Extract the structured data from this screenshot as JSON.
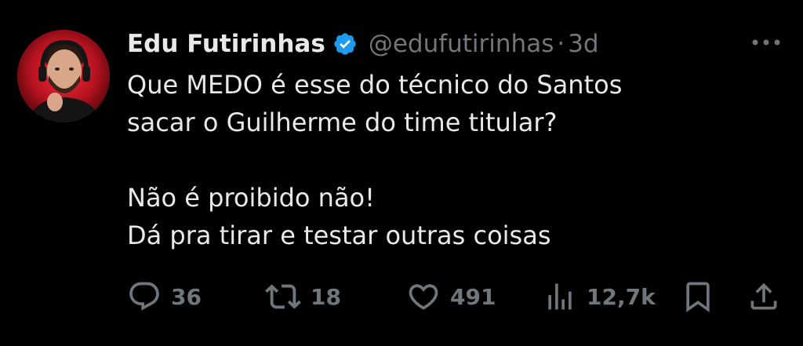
{
  "tweet": {
    "author": {
      "name": "Edu Futirinhas",
      "handle": "@edufutirinhas",
      "verified": true,
      "verified_color": "#1d9bf0"
    },
    "separator": "·",
    "time": "3d",
    "text_lines": [
      "Que MEDO é esse do técnico do Santos",
      "sacar o Guilherme do time titular?",
      "",
      "Não é proibido não!",
      "Dá pra tirar e testar outras coisas"
    ],
    "actions": {
      "replies": "36",
      "retweets": "18",
      "likes": "491",
      "views": "12,7k"
    },
    "icons": {
      "reply": "reply-icon",
      "retweet": "retweet-icon",
      "like": "heart-icon",
      "views": "views-icon",
      "bookmark": "bookmark-icon",
      "share": "share-icon",
      "more": "more-icon"
    }
  },
  "theme": {
    "background": "#000000",
    "text": "#e7e9ea",
    "muted": "#71767b"
  }
}
